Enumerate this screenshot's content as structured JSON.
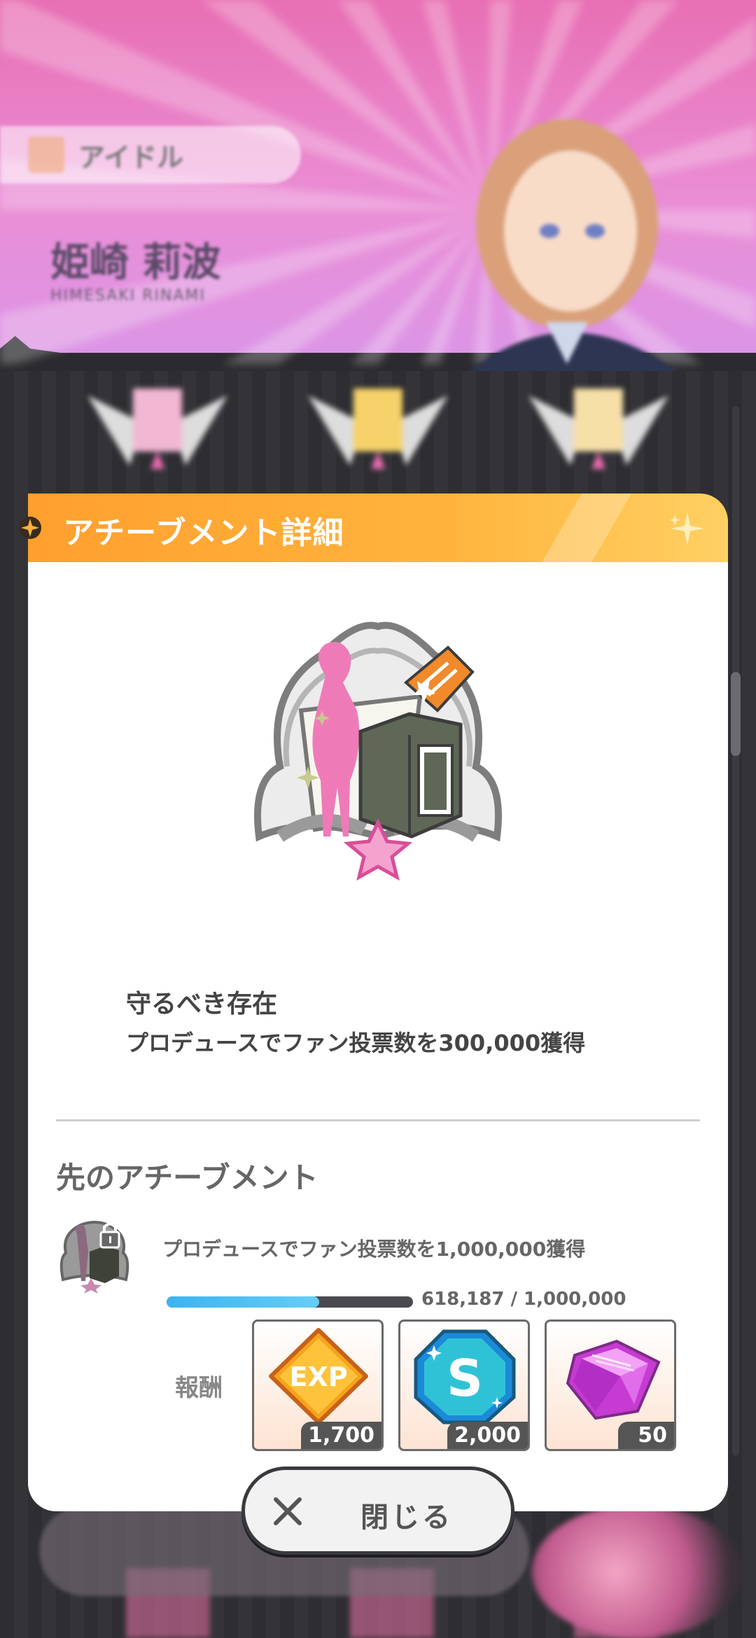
{
  "background": {
    "category_label": "アイドル",
    "character_name": "姫崎 莉波",
    "character_name_en": "HIMESAKI RINAMI"
  },
  "modal": {
    "title": "アチーブメント詳細",
    "achievement": {
      "name": "守るべき存在",
      "description": "プロデュースでファン投票数を300,000獲得"
    },
    "next": {
      "title": "先のアチーブメント",
      "description": "プロデュースでファン投票数を1,000,000獲得",
      "progress_text": "618,187 / 1,000,000",
      "progress_fraction": 0.618187
    },
    "rewards": {
      "label": "報酬",
      "items": [
        {
          "icon": "exp-icon",
          "count": "1,700"
        },
        {
          "icon": "skill-point-icon",
          "count": "2,000"
        },
        {
          "icon": "jewel-icon",
          "count": "50"
        }
      ]
    }
  },
  "close_button": {
    "label": "閉じる"
  },
  "colors": {
    "header": "#ffa834",
    "progress": "#3bb4f0",
    "accent_pink": "#ec6fb1"
  }
}
